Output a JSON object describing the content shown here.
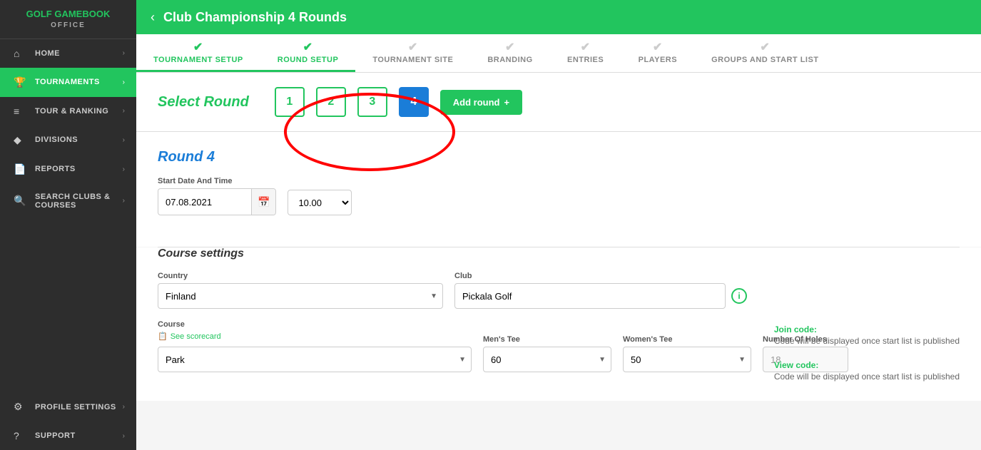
{
  "sidebar": {
    "logo_line1": "GOLF GAMEBOOK",
    "logo_line2": "OFFICE",
    "items": [
      {
        "id": "home",
        "label": "HOME",
        "icon": "⌂",
        "active": false
      },
      {
        "id": "tournaments",
        "label": "TOURNAMENTS",
        "icon": "🏆",
        "active": true
      },
      {
        "id": "tour-ranking",
        "label": "TOUR & RANKING",
        "icon": "≡",
        "active": false
      },
      {
        "id": "divisions",
        "label": "DIVISIONS",
        "icon": "◆",
        "active": false
      },
      {
        "id": "reports",
        "label": "REPORTS",
        "icon": "📄",
        "active": false
      },
      {
        "id": "search-clubs",
        "label": "SEARCH CLUBS & COURSES",
        "icon": "🔍",
        "active": false
      },
      {
        "id": "profile-settings",
        "label": "PROFILE SETTINGS",
        "icon": "⚙",
        "active": false
      },
      {
        "id": "support",
        "label": "SUPPORT",
        "icon": "?",
        "active": false
      }
    ]
  },
  "topbar": {
    "back_icon": "‹",
    "title": "Club Championship 4 Rounds"
  },
  "tabs": [
    {
      "id": "tournament-setup",
      "label": "TOURNAMENT SETUP",
      "done": true,
      "active": false
    },
    {
      "id": "round-setup",
      "label": "ROUND SETUP",
      "done": true,
      "active": true
    },
    {
      "id": "tournament-site",
      "label": "TOURNAMENT SITE",
      "done": false,
      "active": false
    },
    {
      "id": "branding",
      "label": "BRANDING",
      "done": false,
      "active": false
    },
    {
      "id": "entries",
      "label": "ENTRIES",
      "done": false,
      "active": false
    },
    {
      "id": "players",
      "label": "PLAYERS",
      "done": false,
      "active": false
    },
    {
      "id": "groups-start-list",
      "label": "GROUPS AND START LIST",
      "done": false,
      "active": false
    }
  ],
  "round_selector": {
    "label": "Select Round",
    "rounds": [
      "1",
      "2",
      "3",
      "4"
    ],
    "active_round": 4,
    "add_round_label": "Add round",
    "add_round_icon": "+"
  },
  "round_detail": {
    "title": "Round 4",
    "start_date_label": "Start Date And Time",
    "date_value": "07.08.2021",
    "time_value": "10.00",
    "join_code_label": "Join code:",
    "join_code_value": "Code will be displayed once start list is published",
    "view_code_label": "View code:",
    "view_code_value": "Code will be displayed once start list is published"
  },
  "course_settings": {
    "section_title": "Course settings",
    "country_label": "Country",
    "country_value": "Finland",
    "club_label": "Club",
    "club_value": "Pickala Golf",
    "course_label": "Course",
    "course_value": "Park",
    "scorecard_link": "See scorecard",
    "mens_tee_label": "Men's Tee",
    "mens_tee_value": "60",
    "womens_tee_label": "Women's Tee",
    "womens_tee_value": "50",
    "holes_label": "Number Of Holes",
    "holes_value": "18"
  }
}
